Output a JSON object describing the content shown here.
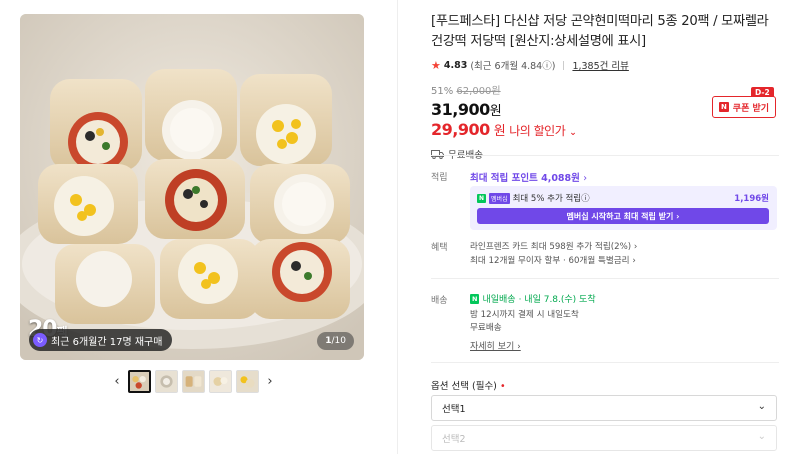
{
  "gallery": {
    "badge_number": "20",
    "badge_unit": "팩",
    "repurchase_text": "최근 6개월간 17명 재구매",
    "page_current": "1",
    "page_total": "/10",
    "prev_arrow": "‹",
    "next_arrow": "›",
    "thumbnail_count": 5
  },
  "product": {
    "title": "[푸드페스타] 다신샵 저당 곤약현미떡마리 5종 20팩 / 모짜렐라 건강떡 저당떡 [원산지:상세설명에 표시]",
    "rating": "4.83",
    "rating_detail": "(최근 6개월 4.84ⓘ)",
    "review_count": "1,385건 리뷰",
    "discount_pct": "51%",
    "original_price": "62,000원",
    "price": "31,900",
    "price_unit": "원",
    "my_price": "29,900",
    "my_price_unit": "원",
    "my_price_label": "나의 할인가",
    "coupon_badge": "D-2",
    "coupon_n": "N",
    "coupon_label": "쿠폰 받기",
    "shipping": "무료배송"
  },
  "info": {
    "points_label": "적립",
    "points_text": "최대 적립 포인트 4,088원",
    "membership_text": "최대 5% 추가 적립ⓘ",
    "membership_tag1": "N",
    "membership_tag2": "멤버십",
    "membership_amount": "1,196원",
    "membership_button": "멤버십 시작하고 최대 적립 받기 ›",
    "benefit_label": "혜택",
    "benefit_line1": "라인프렌즈 카드 최대 598원 추가 적립(2%) ›",
    "benefit_line2": "최대 12개월 무이자 할부 · 60개월 특별금리 ›",
    "delivery_label": "배송",
    "delivery_tag": "N",
    "delivery_tag_text": "내일배송",
    "delivery_date": "· 내일 7.8.(수) 도착",
    "delivery_sub1": "밤 12시까지 결제 시 내일도착",
    "delivery_sub2": "무료배송",
    "detail_link": "자세히 보기 ›"
  },
  "options": {
    "label": "옵션 선택 (필수)",
    "required_mark": "•",
    "select1": "선택1",
    "select2": "선택2"
  }
}
